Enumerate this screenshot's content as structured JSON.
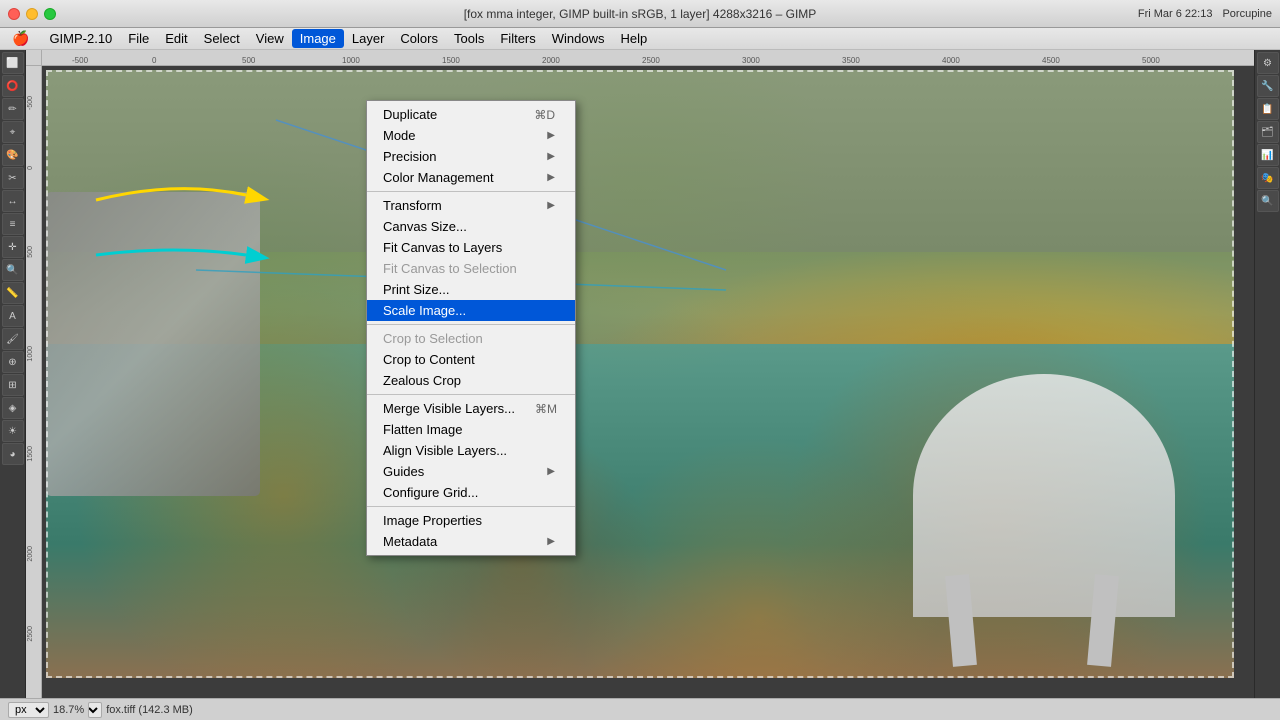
{
  "titlebar": {
    "title": "[fox  mma integer, GIMP built-in sRGB, 1 layer] 4288x3216 – GIMP",
    "date_time": "Fri Mar 6  22:13",
    "user": "Porcupine"
  },
  "menubar": {
    "apple": "🍎",
    "items": [
      {
        "label": "GIMP-2.10",
        "id": "gimp"
      },
      {
        "label": "File",
        "id": "file"
      },
      {
        "label": "Edit",
        "id": "edit"
      },
      {
        "label": "Select",
        "id": "select"
      },
      {
        "label": "View",
        "id": "view"
      },
      {
        "label": "Image",
        "id": "image",
        "active": true
      },
      {
        "label": "Layer",
        "id": "layer"
      },
      {
        "label": "Colors",
        "id": "colors"
      },
      {
        "label": "Tools",
        "id": "tools"
      },
      {
        "label": "Filters",
        "id": "filters"
      },
      {
        "label": "Windows",
        "id": "windows"
      },
      {
        "label": "Help",
        "id": "help"
      }
    ]
  },
  "image_menu": {
    "items": [
      {
        "label": "Duplicate",
        "shortcut": "⌘D",
        "has_submenu": false,
        "disabled": false,
        "id": "duplicate"
      },
      {
        "label": "Mode",
        "has_submenu": true,
        "disabled": false,
        "id": "mode"
      },
      {
        "label": "Precision",
        "has_submenu": true,
        "disabled": false,
        "id": "precision"
      },
      {
        "label": "Color Management",
        "has_submenu": true,
        "disabled": false,
        "id": "color-management"
      },
      {
        "divider": true
      },
      {
        "label": "Transform",
        "has_submenu": true,
        "disabled": false,
        "id": "transform"
      },
      {
        "label": "Canvas Size...",
        "has_submenu": false,
        "disabled": false,
        "id": "canvas-size"
      },
      {
        "label": "Fit Canvas to Layers",
        "has_submenu": false,
        "disabled": false,
        "id": "fit-canvas-layers"
      },
      {
        "label": "Fit Canvas to Selection",
        "has_submenu": false,
        "disabled": true,
        "id": "fit-canvas-selection"
      },
      {
        "label": "Print Size...",
        "has_submenu": false,
        "disabled": false,
        "id": "print-size"
      },
      {
        "label": "Scale Image...",
        "has_submenu": false,
        "disabled": false,
        "id": "scale-image",
        "highlighted": true
      },
      {
        "divider": true
      },
      {
        "label": "Crop to Selection",
        "has_submenu": false,
        "disabled": true,
        "id": "crop-selection"
      },
      {
        "label": "Crop to Content",
        "has_submenu": false,
        "disabled": false,
        "id": "crop-content"
      },
      {
        "label": "Zealous Crop",
        "has_submenu": false,
        "disabled": false,
        "id": "zealous-crop"
      },
      {
        "divider": true
      },
      {
        "label": "Merge Visible Layers...",
        "shortcut": "⌘M",
        "has_submenu": false,
        "disabled": false,
        "id": "merge-visible"
      },
      {
        "label": "Flatten Image",
        "has_submenu": false,
        "disabled": false,
        "id": "flatten"
      },
      {
        "label": "Align Visible Layers...",
        "has_submenu": false,
        "disabled": false,
        "id": "align-visible"
      },
      {
        "label": "Guides",
        "has_submenu": true,
        "disabled": false,
        "id": "guides"
      },
      {
        "label": "Configure Grid...",
        "has_submenu": false,
        "disabled": false,
        "id": "configure-grid"
      },
      {
        "divider": true
      },
      {
        "label": "Image Properties",
        "has_submenu": false,
        "disabled": false,
        "id": "image-properties"
      },
      {
        "label": "Metadata",
        "has_submenu": true,
        "disabled": false,
        "id": "metadata"
      }
    ]
  },
  "statusbar": {
    "unit": "px",
    "zoom": "18.7%",
    "filename": "fox.tiff (142.3 MB)"
  }
}
